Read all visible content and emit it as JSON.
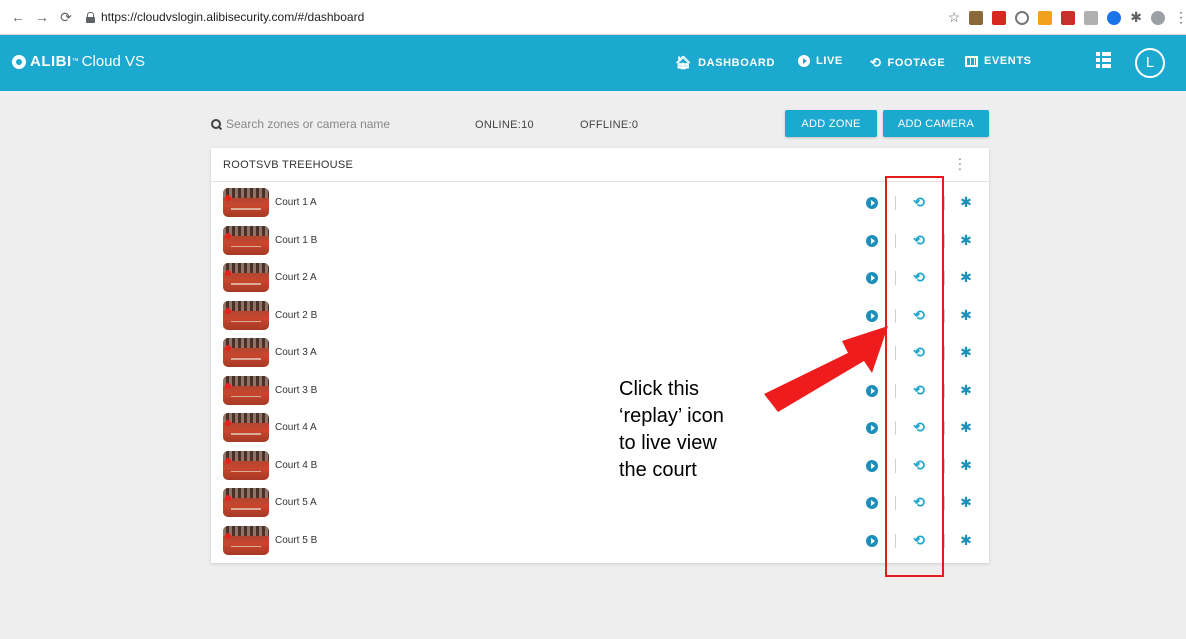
{
  "browser": {
    "url": "https://cloudvslogin.alibisecurity.com/#/dashboard",
    "back_icon": "arrow-left",
    "forward_icon": "arrow-right",
    "reload_icon": "reload",
    "extension_colors": [
      "#8a6a3a",
      "#d6281f",
      "#777777",
      "#f2a11c",
      "#c9302c",
      "#b0b0b0",
      "#1a73e8"
    ]
  },
  "header": {
    "brand_name": "ALIBI",
    "brand_tm": "™",
    "brand_sub": "Cloud VS",
    "color": "#1ca9cf",
    "nav": [
      {
        "label": "DASHBOARD",
        "icon": "home-icon"
      },
      {
        "label": "LIVE",
        "icon": "play-circle-icon"
      },
      {
        "label": "FOOTAGE",
        "icon": "history-icon"
      },
      {
        "label": "EVENTS",
        "icon": "film-icon"
      }
    ],
    "avatar_letter": "L"
  },
  "toolbar": {
    "search_placeholder": "Search zones or camera name",
    "online": "ONLINE:10",
    "offline": "OFFLINE:0",
    "add_zone": "ADD ZONE",
    "add_camera": "ADD CAMERA"
  },
  "zone": {
    "name": "ROOTSVB TREEHOUSE",
    "cameras": [
      {
        "name": "Court 1 A"
      },
      {
        "name": "Court 1 B"
      },
      {
        "name": "Court 2 A"
      },
      {
        "name": "Court 2 B"
      },
      {
        "name": "Court 3 A"
      },
      {
        "name": "Court 3 B"
      },
      {
        "name": "Court 4 A"
      },
      {
        "name": "Court 4 B"
      },
      {
        "name": "Court 5 A"
      },
      {
        "name": "Court 5 B"
      }
    ]
  },
  "annotation": {
    "callout": "Click this\n‘replay’ icon\nto live view\nthe court",
    "color": "#e31b1b"
  }
}
